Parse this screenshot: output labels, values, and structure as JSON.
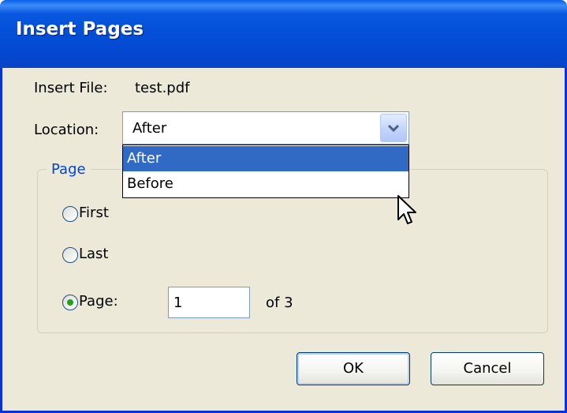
{
  "window": {
    "title": "Insert Pages"
  },
  "insert_file": {
    "label": "Insert File:",
    "value": "test.pdf"
  },
  "location": {
    "label": "Location:",
    "selected": "After",
    "options": [
      "After",
      "Before"
    ],
    "highlighted_index": 0
  },
  "page_group": {
    "legend": "Page",
    "radios": [
      {
        "label": "First",
        "checked": false
      },
      {
        "label": "Last",
        "checked": false
      },
      {
        "label": "Page:",
        "checked": true
      }
    ],
    "page_number_value": "1",
    "of_text": "of 3"
  },
  "buttons": {
    "ok": "OK",
    "cancel": "Cancel"
  },
  "colors": {
    "titlebar": "#0450d8",
    "dialog_bg": "#ece9d8",
    "selection": "#316ac5",
    "group_legend": "#0046d5",
    "radio_dot": "#21a121"
  },
  "icons": {
    "combo_arrow": "chevron-down-icon",
    "cursor": "arrow-cursor-icon"
  }
}
